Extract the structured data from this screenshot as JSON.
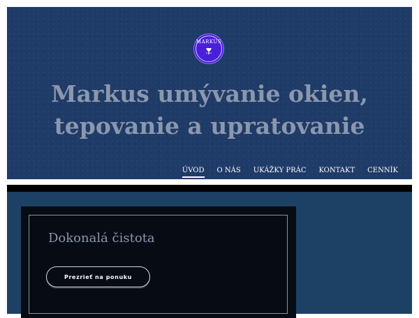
{
  "header": {
    "logo": {
      "name": "MARKUS",
      "icon": "window-cleaner-mark-icon",
      "color": "#4a1fd9"
    },
    "title_line1": "Markus umývanie okien,",
    "title_line2": "tepovanie a upratovanie",
    "background_color": "#1f3b68"
  },
  "nav": {
    "items": [
      {
        "label": "ÚVOD",
        "active": true
      },
      {
        "label": "O NÁS",
        "active": false
      },
      {
        "label": "UKÁŽKY PRÁC",
        "active": false
      },
      {
        "label": "KONTAKT",
        "active": false
      },
      {
        "label": "CENNÍK",
        "active": false
      }
    ]
  },
  "main": {
    "background_color": "#1d4164",
    "card": {
      "heading": "Dokonalá čistota",
      "button_label": "Prezrieť na ponuku"
    }
  }
}
